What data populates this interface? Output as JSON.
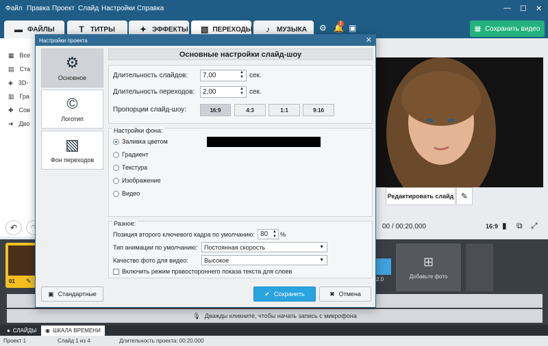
{
  "menu": [
    "Файл",
    "Правка",
    "Проект",
    "Слайд",
    "Настройки",
    "Справка"
  ],
  "tabs": [
    {
      "label": "ФАЙЛЫ",
      "icon": "folder-icon"
    },
    {
      "label": "ТИТРЫ",
      "icon": "text-icon"
    },
    {
      "label": "ЭФФЕКТЫ",
      "icon": "effects-icon"
    },
    {
      "label": "ПЕРЕХОДЫ",
      "icon": "transitions-icon"
    },
    {
      "label": "МУЗЫКА",
      "icon": "music-icon"
    }
  ],
  "notification_count": "1",
  "save_video": "Сохранить видео",
  "left_items": [
    "Все",
    "Ста",
    "3D-",
    "Гра",
    "Сов",
    "Дво"
  ],
  "edit_slide": "Редактировать слайд",
  "timecode": "00 / 00:20.000",
  "aspect": "16:9",
  "slide_number": "01",
  "clip_duration": "2.0",
  "add_photo": "Добавьте фото",
  "mic_hint": "Дважды кликните, чтобы начать запись с микрофона",
  "bottom_tabs": [
    "СЛАЙДЫ",
    "ШКАЛА ВРЕМЕНИ"
  ],
  "status": {
    "project": "Проект 1",
    "slide": "Слайд 1 из 4",
    "duration": "Длительность проекта: 00:20.000"
  },
  "dialog": {
    "title": "Настройки проекта",
    "sidebar": [
      {
        "label": "Основное",
        "icon": "gear-icon"
      },
      {
        "label": "Логотип",
        "icon": "copyright-icon"
      },
      {
        "label": "Фон переходов",
        "icon": "layers-icon"
      }
    ],
    "header": "Основные настройки слайд-шоу",
    "slide_duration_label": "Длительность слайдов:",
    "slide_duration": "7,00",
    "transition_duration_label": "Длительность переходов:",
    "transition_duration": "2,00",
    "unit": "сек.",
    "ratio_label": "Пропорции слайд-шоу:",
    "ratios": [
      "16:9",
      "4:3",
      "1:1",
      "9:16"
    ],
    "bg_section": "Настройки фона:",
    "bg_options": [
      "Заливка цветом",
      "Градиент",
      "Текстура",
      "Изображение",
      "Видео"
    ],
    "bg_color": "#000000",
    "misc_section": "Разное:",
    "keyframe_label": "Позиция второго ключевого кадра по умолчанию:",
    "keyframe_value": "80",
    "percent": "%",
    "anim_label": "Тип анимации по умолчанию:",
    "anim_value": "Постоянная скорость",
    "quality_label": "Качество фото для видео:",
    "quality_value": "Высокое",
    "rtl_label": "Включить режим правостороннего показа текста для слоев",
    "btn_default": "Стандартные",
    "btn_save": "Сохранить",
    "btn_cancel": "Отмена"
  }
}
